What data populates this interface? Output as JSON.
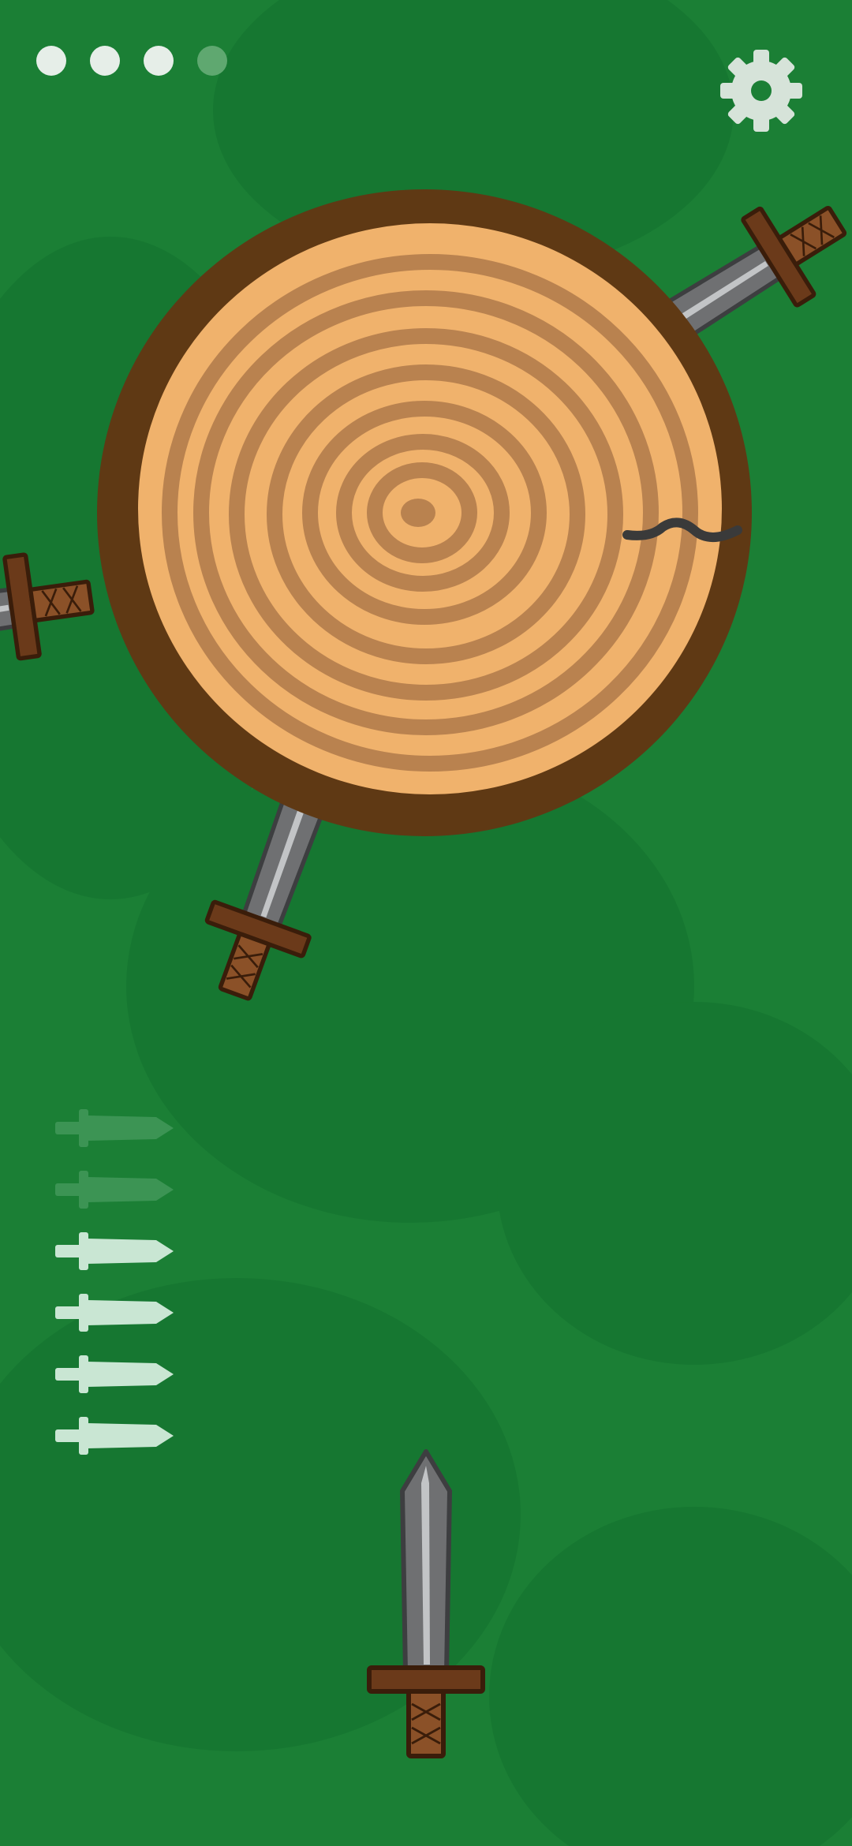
{
  "colors": {
    "background": "#1b7f35",
    "background_dark": "#0f6a2a",
    "bark": "#5f3914",
    "wood_light": "#f0b26c",
    "wood_ring": "#b9824f",
    "blade": "#6f7072",
    "blade_highlight": "#c2c4c6",
    "handle": "#6b3a1a",
    "stage_dot_done": "#e6eee8",
    "stage_dot_pending": "#5fa870",
    "settings_icon": "#d6e3d9",
    "knife_counter_available": "#c9e6d3",
    "knife_counter_used": "#3c9454"
  },
  "hud": {
    "stages": [
      {
        "status": "done"
      },
      {
        "status": "done"
      },
      {
        "status": "done"
      },
      {
        "status": "current"
      }
    ],
    "settings_icon": "gear-icon"
  },
  "knife_counter": {
    "total": 6,
    "used": 2,
    "remaining": 4
  },
  "target": {
    "type": "log",
    "crack_visible": true,
    "stuck_knives": 3
  },
  "player_knife": {
    "icon": "sword-icon"
  }
}
